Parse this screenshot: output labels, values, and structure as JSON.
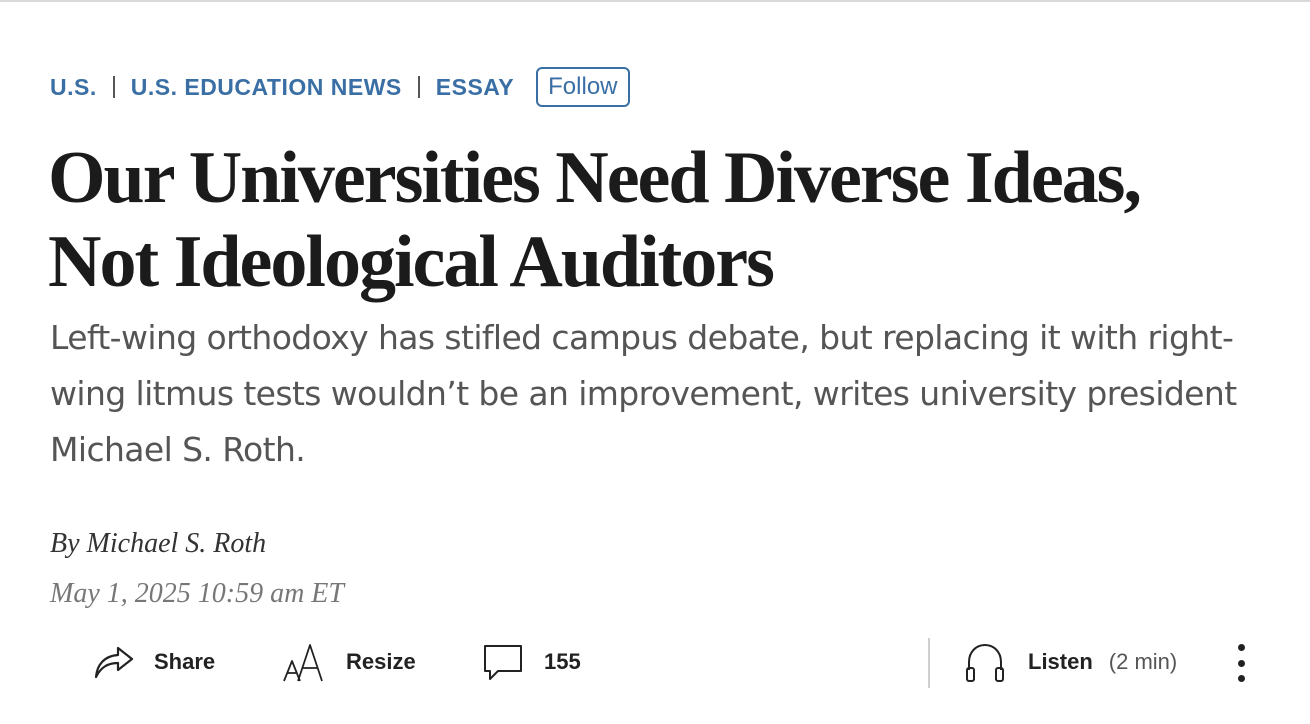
{
  "breadcrumb": {
    "items": [
      "U.S.",
      "U.S. EDUCATION NEWS",
      "ESSAY"
    ],
    "follow_label": "Follow"
  },
  "article": {
    "headline_line1": "Our Universities Need Diverse Ideas,",
    "headline_line2": "Not Ideological Auditors",
    "dek": "Left-wing orthodoxy has stifled campus debate, but replacing it with right-wing litmus tests wouldn’t be an improvement, writes university president Michael S. Roth.",
    "byline_prefix": "By",
    "author": "Michael S. Roth",
    "timestamp": "May 1, 2025 10:59 am ET"
  },
  "toolbar": {
    "share_label": "Share",
    "resize_label": "Resize",
    "comment_count": "155",
    "listen_label": "Listen",
    "listen_duration": "(2 min)"
  },
  "icons": {
    "share": "share-arrow-icon",
    "resize": "text-resize-icon",
    "comments": "speech-bubble-icon",
    "listen": "headphones-icon",
    "more": "vertical-ellipsis-icon"
  },
  "colors": {
    "accent": "#3a6fa5",
    "headline": "#1b1b1b",
    "dek": "#555555"
  }
}
